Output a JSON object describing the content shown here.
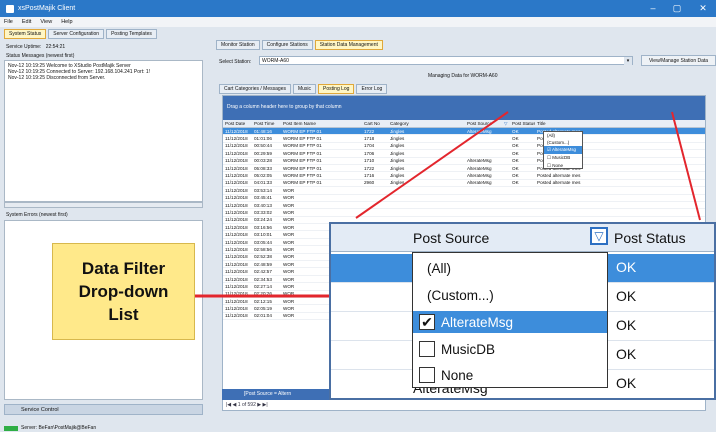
{
  "window": {
    "title": "xsPostMajik Client",
    "controls": [
      "–",
      "▢",
      "✕"
    ]
  },
  "menu": [
    "File",
    "Edit",
    "View",
    "Help"
  ],
  "left": {
    "tabs": [
      "System Status",
      "Server Configuration",
      "Posting Templates"
    ],
    "uptime_label": "Service Uptime:",
    "uptime_value": "22:54:21",
    "status_messages_label": "Status Messages (newest first)",
    "status_messages": [
      "Nov-12 10:19:25  Welcome to XStudio PostMajik Server",
      "Nov-12 10:19:25  Connected to Server: 192.168.104.241 Port: 1!",
      "Nov-12 10:19:25  Disconnected from Server."
    ],
    "errors_label": "System Errors (newest first)",
    "service_control": "Service Control"
  },
  "right": {
    "tabs": [
      "Monitor Station",
      "Configure Stations",
      "Station Data Management"
    ],
    "select_station_label": "Select Station:",
    "select_station_value": "WORM-A60",
    "view_manage_button": "View/Manage Station Data",
    "managing_label": "Managing Data for WORM-A60",
    "subtabs": [
      "Cart Categories / Messages",
      "Music",
      "Posting Log",
      "Error Log"
    ],
    "group_hint": "Drag a column header here to group by that column",
    "columns": [
      "Post Date",
      "Post Time",
      "Post Item Name",
      "Cart No",
      "Category",
      "Post Source",
      "Post Status",
      "Title"
    ],
    "rows": [
      {
        "date": "11/12/2018",
        "time": "01:48:16",
        "item": "WORM EP FTP 01",
        "cart": "1722",
        "cat": "Jingles",
        "src": "AlterateMsg",
        "status": "OK",
        "title": "Posted alternate mes"
      },
      {
        "date": "11/12/2018",
        "time": "01:01:06",
        "item": "WORM EP FTP 01",
        "cart": "1718",
        "cat": "Jingles",
        "src": "",
        "status": "OK",
        "title": "Posted alternate mes"
      },
      {
        "date": "11/12/2018",
        "time": "00:50:44",
        "item": "WORM EP FTP 01",
        "cart": "1704",
        "cat": "Jingles",
        "src": "",
        "status": "OK",
        "title": "Posted alternate mes"
      },
      {
        "date": "11/12/2018",
        "time": "00:29:59",
        "item": "WORM EP FTP 01",
        "cart": "1706",
        "cat": "Jingles",
        "src": "",
        "status": "OK",
        "title": "Posted alternate mes"
      },
      {
        "date": "11/12/2018",
        "time": "00:03:28",
        "item": "WORM EP FTP 01",
        "cart": "1710",
        "cat": "Jingles",
        "src": "AlterateMsg",
        "status": "OK",
        "title": "Posted alternate mes"
      },
      {
        "date": "11/12/2018",
        "time": "05:08:33",
        "item": "WORM EP FTP 01",
        "cart": "1722",
        "cat": "Jingles",
        "src": "AlterateMsg",
        "status": "OK",
        "title": "Posted alternate mes"
      },
      {
        "date": "11/12/2018",
        "time": "05:02:05",
        "item": "WORM EP FTP 01",
        "cart": "1716",
        "cat": "Jingles",
        "src": "AlterateMsg",
        "status": "OK",
        "title": "Posted alternate mes"
      },
      {
        "date": "11/12/2018",
        "time": "04:01:33",
        "item": "WORM EP FTP 01",
        "cart": "2960",
        "cat": "Jingles",
        "src": "AlterateMsg",
        "status": "OK",
        "title": "Posted alternate mes"
      },
      {
        "date": "11/12/2018",
        "time": "03:53:14",
        "item": "WOR",
        "cart": "",
        "cat": "",
        "src": "",
        "status": "",
        "title": ""
      },
      {
        "date": "11/12/2018",
        "time": "03:45:41",
        "item": "WOR",
        "cart": "",
        "cat": "",
        "src": "",
        "status": "",
        "title": ""
      },
      {
        "date": "11/12/2018",
        "time": "03:40:13",
        "item": "WOR",
        "cart": "",
        "cat": "",
        "src": "",
        "status": "",
        "title": ""
      },
      {
        "date": "11/12/2018",
        "time": "03:33:02",
        "item": "WOR",
        "cart": "",
        "cat": "",
        "src": "",
        "status": "",
        "title": ""
      },
      {
        "date": "11/12/2018",
        "time": "03:24:24",
        "item": "WOR",
        "cart": "",
        "cat": "",
        "src": "",
        "status": "",
        "title": ""
      },
      {
        "date": "11/12/2018",
        "time": "03:16:56",
        "item": "WOR",
        "cart": "",
        "cat": "",
        "src": "",
        "status": "",
        "title": ""
      },
      {
        "date": "11/12/2018",
        "time": "03:10:01",
        "item": "WOR",
        "cart": "",
        "cat": "",
        "src": "",
        "status": "",
        "title": ""
      },
      {
        "date": "11/12/2018",
        "time": "03:05:44",
        "item": "WOR",
        "cart": "",
        "cat": "",
        "src": "",
        "status": "",
        "title": ""
      },
      {
        "date": "11/12/2018",
        "time": "02:58:56",
        "item": "WOR",
        "cart": "",
        "cat": "",
        "src": "",
        "status": "",
        "title": ""
      },
      {
        "date": "11/12/2018",
        "time": "02:52:38",
        "item": "WOR",
        "cart": "",
        "cat": "",
        "src": "",
        "status": "",
        "title": ""
      },
      {
        "date": "11/12/2018",
        "time": "02:48:59",
        "item": "WOR",
        "cart": "",
        "cat": "",
        "src": "",
        "status": "",
        "title": ""
      },
      {
        "date": "11/12/2018",
        "time": "02:42:57",
        "item": "WOR",
        "cart": "",
        "cat": "",
        "src": "",
        "status": "",
        "title": ""
      },
      {
        "date": "11/12/2018",
        "time": "02:34:53",
        "item": "WOR",
        "cart": "",
        "cat": "",
        "src": "",
        "status": "",
        "title": ""
      },
      {
        "date": "11/12/2018",
        "time": "02:27:14",
        "item": "WOR",
        "cart": "",
        "cat": "",
        "src": "",
        "status": "",
        "title": ""
      },
      {
        "date": "11/12/2018",
        "time": "02:20:26",
        "item": "WOR",
        "cart": "",
        "cat": "",
        "src": "",
        "status": "",
        "title": ""
      },
      {
        "date": "11/12/2018",
        "time": "02:12:15",
        "item": "WOR",
        "cart": "",
        "cat": "",
        "src": "",
        "status": "",
        "title": ""
      },
      {
        "date": "11/12/2018",
        "time": "02:05:19",
        "item": "WOR",
        "cart": "",
        "cat": "",
        "src": "",
        "status": "",
        "title": ""
      },
      {
        "date": "11/12/2018",
        "time": "02:01:04",
        "item": "WOR",
        "cart": "",
        "cat": "",
        "src": "",
        "status": "",
        "title": ""
      }
    ],
    "filter_status": "[Post Source = Altern",
    "pager": "1 of 592"
  },
  "small_filter": [
    "(All)",
    "(Custom...)",
    "AlterateMsg",
    "MusicDB",
    "None"
  ],
  "zoom": {
    "col_source": "Post Source",
    "col_status": "Post Status",
    "status_values": [
      "OK",
      "OK",
      "OK",
      "OK",
      "OK"
    ],
    "bottom_source": "AlterateMsg"
  },
  "dropdown": {
    "items": [
      {
        "label": "(All)",
        "checkbox": false,
        "checked": false
      },
      {
        "label": "(Custom...)",
        "checkbox": false,
        "checked": false
      },
      {
        "label": "AlterateMsg",
        "checkbox": true,
        "checked": true
      },
      {
        "label": "MusicDB",
        "checkbox": true,
        "checked": false
      },
      {
        "label": "None",
        "checkbox": true,
        "checked": false
      }
    ]
  },
  "callout": {
    "line1": "Data Filter",
    "line2": "Drop-down",
    "line3": "List"
  },
  "statusbar": {
    "server": "Server: BeFan\\PostMajik@BeFan"
  },
  "colors": {
    "accent": "#3d8ddb",
    "arrow": "#e3262d",
    "callout": "#ffe98a"
  }
}
